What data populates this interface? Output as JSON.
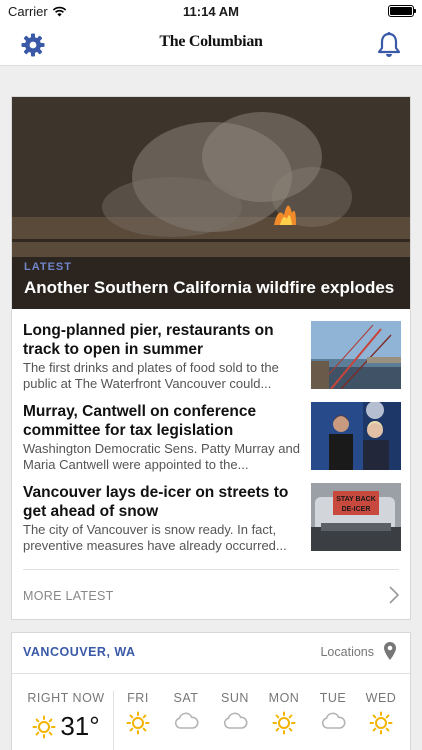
{
  "status_bar": {
    "carrier": "Carrier",
    "time": "11:14 AM"
  },
  "nav": {
    "logo": "The Columbian",
    "settings_icon": "gear-icon",
    "notifications_icon": "bell-icon",
    "accent_color": "#3a5aa8"
  },
  "hero": {
    "tag": "LATEST",
    "headline": "Another Southern California wildfire explodes"
  },
  "stories": [
    {
      "title": "Long-planned pier, restaurants on track to open in summer",
      "summary": "The first drinks and plates of food sold to the public at The Waterfront Vancouver could..."
    },
    {
      "title": "Murray, Cantwell on conference committee for tax legislation",
      "summary": "Washington Democratic Sens. Patty Murray and Maria Cantwell were appointed to the..."
    },
    {
      "title": "Vancouver lays de-icer on streets to get ahead of snow",
      "summary": "The city of Vancouver is snow ready. In fact, preventive measures have already occurred...",
      "thumb_sign_line1": "STAY BACK",
      "thumb_sign_line2": "DE-ICER"
    }
  ],
  "more_latest": "MORE LATEST",
  "weather": {
    "city": "VANCOUVER, WA",
    "locations_label": "Locations",
    "now_label": "RIGHT NOW",
    "now_temp": "31°",
    "now_icon": "sun-icon",
    "days": [
      {
        "label": "FRI",
        "icon": "sun-icon"
      },
      {
        "label": "SAT",
        "icon": "cloud-icon"
      },
      {
        "label": "SUN",
        "icon": "cloud-icon"
      },
      {
        "label": "MON",
        "icon": "sun-icon"
      },
      {
        "label": "TUE",
        "icon": "cloud-icon"
      },
      {
        "label": "WED",
        "icon": "sun-icon"
      }
    ]
  }
}
